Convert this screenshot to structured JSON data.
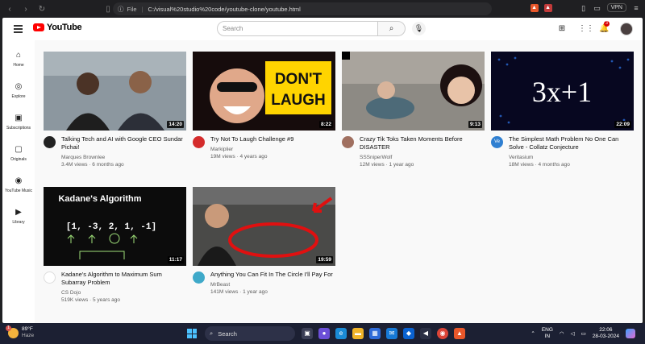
{
  "browser": {
    "file_label": "File",
    "url": "C:/visual%20studio%20code/youtube-clone/youtube.html",
    "vpn_label": "VPN"
  },
  "header": {
    "logo_text": "YouTube",
    "search_placeholder": "Search",
    "notification_count": "3"
  },
  "sidebar": {
    "items": [
      {
        "label": "Home",
        "icon": "home-icon"
      },
      {
        "label": "Explore",
        "icon": "compass-icon"
      },
      {
        "label": "Subscriptions",
        "icon": "subscriptions-icon"
      },
      {
        "label": "Originals",
        "icon": "originals-icon"
      },
      {
        "label": "YouTube Music",
        "icon": "music-icon"
      },
      {
        "label": "Library",
        "icon": "library-icon"
      }
    ]
  },
  "videos": [
    {
      "title": "Talking Tech and AI with Google CEO Sundar Pichai!",
      "channel": "Marques Brownlee",
      "stats": "3.4M views · 6 months ago",
      "duration": "14:20",
      "thumb_color": "#7c8892",
      "avatar_color": "#222222"
    },
    {
      "title": "Try Not To Laugh Challenge #9",
      "channel": "Markiplier",
      "stats": "19M views · 4 years ago",
      "duration": "8:22",
      "thumb_color": "#1a1010",
      "avatar_color": "#d42b2b",
      "thumb_text_1": "DON'T",
      "thumb_text_2": "LAUGH"
    },
    {
      "title": "Crazy Tik Toks Taken Moments Before DISASTER",
      "channel": "SSSniperWolf",
      "stats": "12M views · 1 year ago",
      "duration": "9:13",
      "thumb_color": "#8a8680",
      "avatar_color": "#a07060"
    },
    {
      "title": "The Simplest Math Problem No One Can Solve - Collatz Conjecture",
      "channel": "Veritasium",
      "stats": "18M views · 4 months ago",
      "duration": "22:09",
      "thumb_color": "#0a0a2a",
      "avatar_color": "#2f7fd1",
      "avatar_text": "Ve",
      "thumb_text": "3x+1"
    },
    {
      "title": "Kadane's Algorithm to Maximum Sum Subarray Problem",
      "channel": "CS Dojo",
      "stats": "519K views · 5 years ago",
      "duration": "11:17",
      "thumb_color": "#0d0d0d",
      "avatar_color": "#ffffff",
      "thumb_title": "Kadane's Algorithm",
      "thumb_text": "[1, -3, 2, 1, -1]"
    },
    {
      "title": "Anything You Can Fit In The Circle I'll Pay For",
      "channel": "MrBeast",
      "stats": "141M views · 1 year ago",
      "duration": "19:59",
      "thumb_color": "#3a3a3a",
      "avatar_color": "#3fa9c9"
    }
  ],
  "taskbar": {
    "temp": "89°F",
    "condition": "Haze",
    "weather_badge": "1",
    "search_label": "Search",
    "lang_line1": "ENG",
    "lang_line2": "IN",
    "time": "22:06",
    "date": "28-03-2024"
  }
}
